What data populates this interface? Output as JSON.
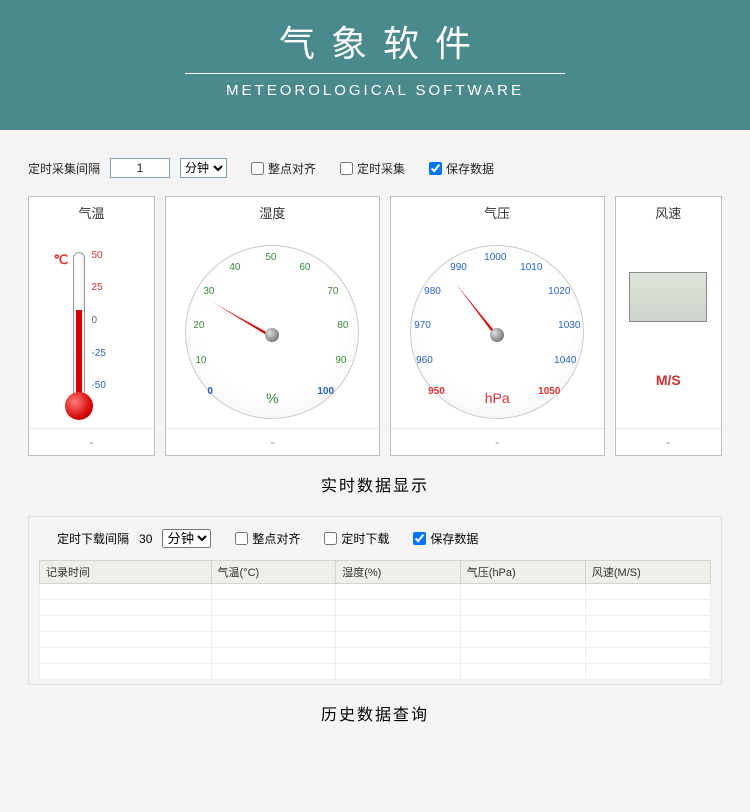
{
  "banner": {
    "title_cn": "气象软件",
    "subtitle": "METEOROLOGICAL SOFTWARE"
  },
  "controls_top": {
    "interval_label": "定时采集间隔",
    "interval_value": "1",
    "unit_options": [
      "分钟"
    ],
    "unit_selected": "分钟",
    "cb_align": "整点对齐",
    "cb_collect": "定时采集",
    "cb_save": "保存数据",
    "cb_align_checked": false,
    "cb_collect_checked": false,
    "cb_save_checked": true
  },
  "panels": {
    "temperature": {
      "title": "气温",
      "unit_symbol": "℃",
      "scale": [
        "50",
        "25",
        "0",
        "-25",
        "-50"
      ],
      "footer": "-"
    },
    "humidity": {
      "title": "湿度",
      "scale": [
        "0",
        "10",
        "20",
        "30",
        "40",
        "50",
        "60",
        "70",
        "80",
        "90",
        "100"
      ],
      "unit": "%",
      "footer": "-"
    },
    "pressure": {
      "title": "气压",
      "scale": [
        "950",
        "960",
        "970",
        "980",
        "990",
        "1000",
        "1010",
        "1020",
        "1030",
        "1040",
        "1050"
      ],
      "unit": "hPa",
      "footer": "-"
    },
    "wind": {
      "title": "风速",
      "unit": "M/S",
      "footer": "-"
    }
  },
  "section_realtime": "实时数据显示",
  "controls_bottom": {
    "interval_label": "定时下载间隔",
    "interval_value": "30",
    "unit_selected": "分钟",
    "cb_align": "整点对齐",
    "cb_download": "定时下载",
    "cb_save": "保存数据",
    "cb_align_checked": false,
    "cb_download_checked": false,
    "cb_save_checked": true
  },
  "history": {
    "columns": [
      "记录时间",
      "气温(°C)",
      "湿度(%)",
      "气压(hPa)",
      "风速(M/S)"
    ]
  },
  "section_history": "历史数据查询"
}
